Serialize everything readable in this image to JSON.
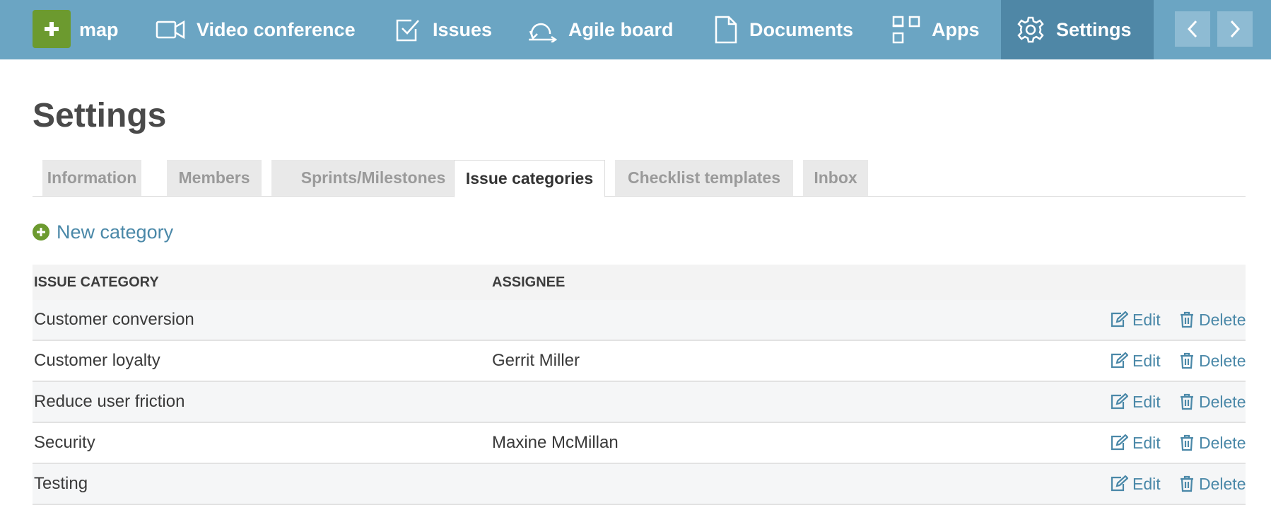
{
  "topnav": {
    "brand_label": "map",
    "items": [
      {
        "label": "Video conference",
        "icon": "video-camera-icon"
      },
      {
        "label": "Issues",
        "icon": "checkbox-icon"
      },
      {
        "label": "Agile board",
        "icon": "agile-cycle-icon"
      },
      {
        "label": "Documents",
        "icon": "document-icon"
      },
      {
        "label": "Apps",
        "icon": "apps-grid-icon"
      },
      {
        "label": "Settings",
        "icon": "gear-icon"
      }
    ],
    "active_item": "Settings"
  },
  "page": {
    "title": "Settings"
  },
  "tabs": [
    {
      "label": "Information"
    },
    {
      "label": "Members"
    },
    {
      "label": "Sprints/Milestones"
    },
    {
      "label": "Issue categories"
    },
    {
      "label": "Checklist templates"
    },
    {
      "label": "Inbox"
    }
  ],
  "active_tab": "Issue categories",
  "new_category_label": "New category",
  "table": {
    "headers": [
      "ISSUE CATEGORY",
      "ASSIGNEE"
    ],
    "edit_label": "Edit",
    "delete_label": "Delete",
    "rows": [
      {
        "category": "Customer conversion",
        "assignee": ""
      },
      {
        "category": "Customer loyalty",
        "assignee": "Gerrit Miller"
      },
      {
        "category": "Reduce user friction",
        "assignee": ""
      },
      {
        "category": "Security",
        "assignee": "Maxine McMillan"
      },
      {
        "category": "Testing",
        "assignee": ""
      }
    ]
  },
  "colors": {
    "nav_background": "#6ba5c3",
    "nav_active": "#4f87a6",
    "add_button": "#6c9a2f",
    "link": "#4a88a8"
  }
}
